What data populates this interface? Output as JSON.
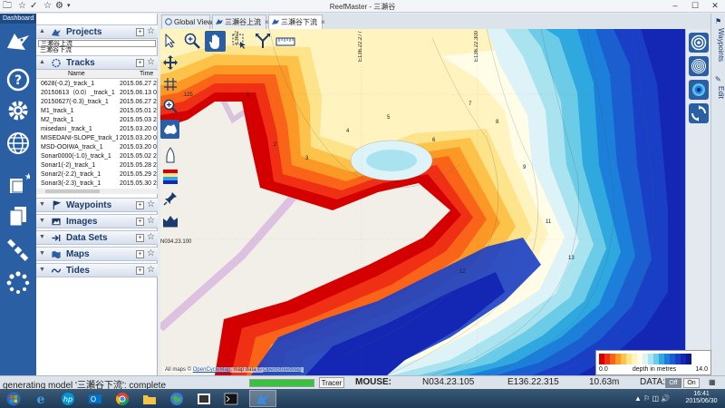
{
  "window": {
    "title": "ReefMaster - 三瀬谷"
  },
  "titlebar": {
    "quick_access": [
      "folder-icon",
      "star-icon",
      "star-check-icon",
      "gear-icon",
      "dropdown-icon"
    ],
    "controls": {
      "minimize": "–",
      "maximize": "☐",
      "close": "✕"
    }
  },
  "dashboard": {
    "title": "Dashboard",
    "icons": [
      "shark-logo-icon",
      "help-icon",
      "settings-gear-icon",
      "globe-icon",
      "new-project-icon",
      "documents-icon",
      "satellite-icon",
      "loading-spinner-icon"
    ]
  },
  "panel": {
    "projects": {
      "label": "Projects",
      "items": [
        "三瀬谷上流",
        "三瀬谷下流"
      ]
    },
    "tracks": {
      "label": "Tracks",
      "columns": [
        "Name",
        "Time"
      ],
      "rows": [
        {
          "name": "0628(-0.2)_track_1",
          "time": "2015.06.27 2"
        },
        {
          "name": "20150613（0.0）_track_1",
          "time": "2015.06.13 0"
        },
        {
          "name": "20150627(-0.3)_track_1",
          "time": "2015.06.27 2"
        },
        {
          "name": "M1_track_1",
          "time": "2015.05.01 2"
        },
        {
          "name": "M2_track_1",
          "time": "2015.05.03 2"
        },
        {
          "name": "misedani _track_1",
          "time": "2015.03.20 0"
        },
        {
          "name": "MISEDANI-SLOPE_track_1",
          "time": "2015.03.20 0"
        },
        {
          "name": "MSD-OOIWA_track_1",
          "time": "2015.03.20 0"
        },
        {
          "name": "Sonar0000(-1.0)_track_1",
          "time": "2015.05.02 2"
        },
        {
          "name": "Sonar1(-2)_track_1",
          "time": "2015.05.28 2"
        },
        {
          "name": "Sonar2(-2.2)_track_1",
          "time": "2015.05.29 2"
        },
        {
          "name": "Sonar3(-2.3)_track_1",
          "time": "2015.05.30 2"
        }
      ]
    },
    "sections": [
      {
        "label": "Waypoints",
        "icon": "waypoint-flag-icon"
      },
      {
        "label": "Images",
        "icon": "image-icon"
      },
      {
        "label": "Data Sets",
        "icon": "dataset-icon"
      },
      {
        "label": "Maps",
        "icon": "map-icon"
      },
      {
        "label": "Tides",
        "icon": "tide-wave-icon"
      }
    ],
    "add_symbol": "+",
    "star_symbol": "☆"
  },
  "tabs": [
    {
      "label": "Global View",
      "closable": false
    },
    {
      "label": "三瀬谷上流",
      "closable": true
    },
    {
      "label": "三瀬谷下流",
      "closable": true,
      "active": true
    }
  ],
  "tab_close": "×",
  "map": {
    "coord_labels": {
      "lon1": "E136.22.277",
      "lon2": "E136.22.300",
      "lon_partial": "136.2",
      "lat1": "N034.23.100",
      "lat_partial": ".125",
      "lat_partial2": ".150"
    },
    "depth_labels": [
      "1",
      "2",
      "3",
      "4",
      "5",
      "6",
      "7",
      "8",
      "9",
      "11",
      "12",
      "13"
    ],
    "attribution": {
      "prefix": "All maps © ",
      "link1": "OpenCycleMap",
      "mid": ", map data © ",
      "link2": "OpenStreetMap"
    }
  },
  "tools_left": [
    "select-arrow-icon",
    "pan-cross-icon",
    "grid-icon",
    "zoom-in-icon",
    "australia-map-icon",
    "boat-icon",
    "layers-icon",
    "pin-tool-icon",
    "depth-profile-icon"
  ],
  "tools_top": [
    "zoom-in-icon",
    "hand-pan-icon",
    "lasso-select-icon",
    "route-split-icon",
    "ruler-icon"
  ],
  "right_tools": [
    "contour-rings-icon",
    "contour-lines-icon",
    "spot-contour-icon",
    "sync-icon"
  ],
  "side_tabs": [
    {
      "label": "Waypoints",
      "icon": "waypoint-flag-icon"
    },
    {
      "label": "Edit",
      "icon": "pencil-icon"
    }
  ],
  "legend": {
    "min": "0.0",
    "label": "depth in metres",
    "max": "14.0",
    "colors": [
      "#d40000",
      "#f03014",
      "#fa6418",
      "#fc9826",
      "#fdc24a",
      "#fde38a",
      "#fff3bf",
      "#fffde8",
      "#ddf3f7",
      "#a9e3ef",
      "#6ccbe6",
      "#2fa8e0",
      "#1c7fd9",
      "#1a5ed0",
      "#1a3fc7",
      "#1427b4",
      "#0c1a8c"
    ]
  },
  "statusbar": {
    "message": "generating model '三瀬谷下流': complete",
    "progress": 1.0,
    "tracer_label": "Tracer",
    "mouse_label": "MOUSE:",
    "lat": "N034.23.105",
    "lon": "E136.22.315",
    "depth": "10.63m",
    "data_label": "DATA:",
    "off_label": "Off",
    "on_label": "On",
    "grid_icon": "grid-icon"
  },
  "taskbar": {
    "apps": [
      "windows-start-icon",
      "ie-icon",
      "hp-icon",
      "outlook-icon",
      "chrome-icon",
      "explorer-folder-icon",
      "google-earth-icon",
      "media-icon",
      "terminal-icon",
      "reefmaster-icon"
    ],
    "tray": "▲ ⚐ ◫ 🔊",
    "time": "16:41",
    "date": "2015/06/30"
  }
}
